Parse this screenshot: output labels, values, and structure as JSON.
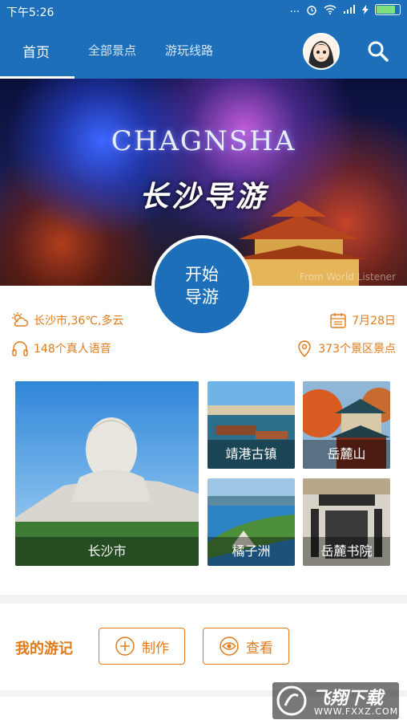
{
  "statusbar": {
    "time": "下午5:26",
    "dots": "..."
  },
  "tabs": [
    {
      "label": "首页",
      "active": true
    },
    {
      "label": "全部景点",
      "active": false
    },
    {
      "label": "游玩线路",
      "active": false
    }
  ],
  "banner": {
    "title_en": "CHAGNSHA",
    "title_cn": "长沙导游",
    "watermark": "From World Listener"
  },
  "start_button": {
    "line1": "开始",
    "line2": "导游"
  },
  "info": {
    "weather": "长沙市,36℃,多云",
    "date": "7月28日",
    "voices": "148个真人语音",
    "spots": "373个景区景点"
  },
  "destinations": [
    {
      "name": "长沙市"
    },
    {
      "name": "靖港古镇"
    },
    {
      "name": "岳麓山"
    },
    {
      "name": "橘子洲"
    },
    {
      "name": "岳麓书院"
    }
  ],
  "journal": {
    "heading": "我的游记",
    "create_label": "制作",
    "view_label": "查看"
  },
  "watermark": {
    "text_cn": "飞翔下载",
    "url": "WWW.FXXZ.COM"
  },
  "colors": {
    "primary": "#1c6fb8",
    "accent": "#e07a1a"
  }
}
